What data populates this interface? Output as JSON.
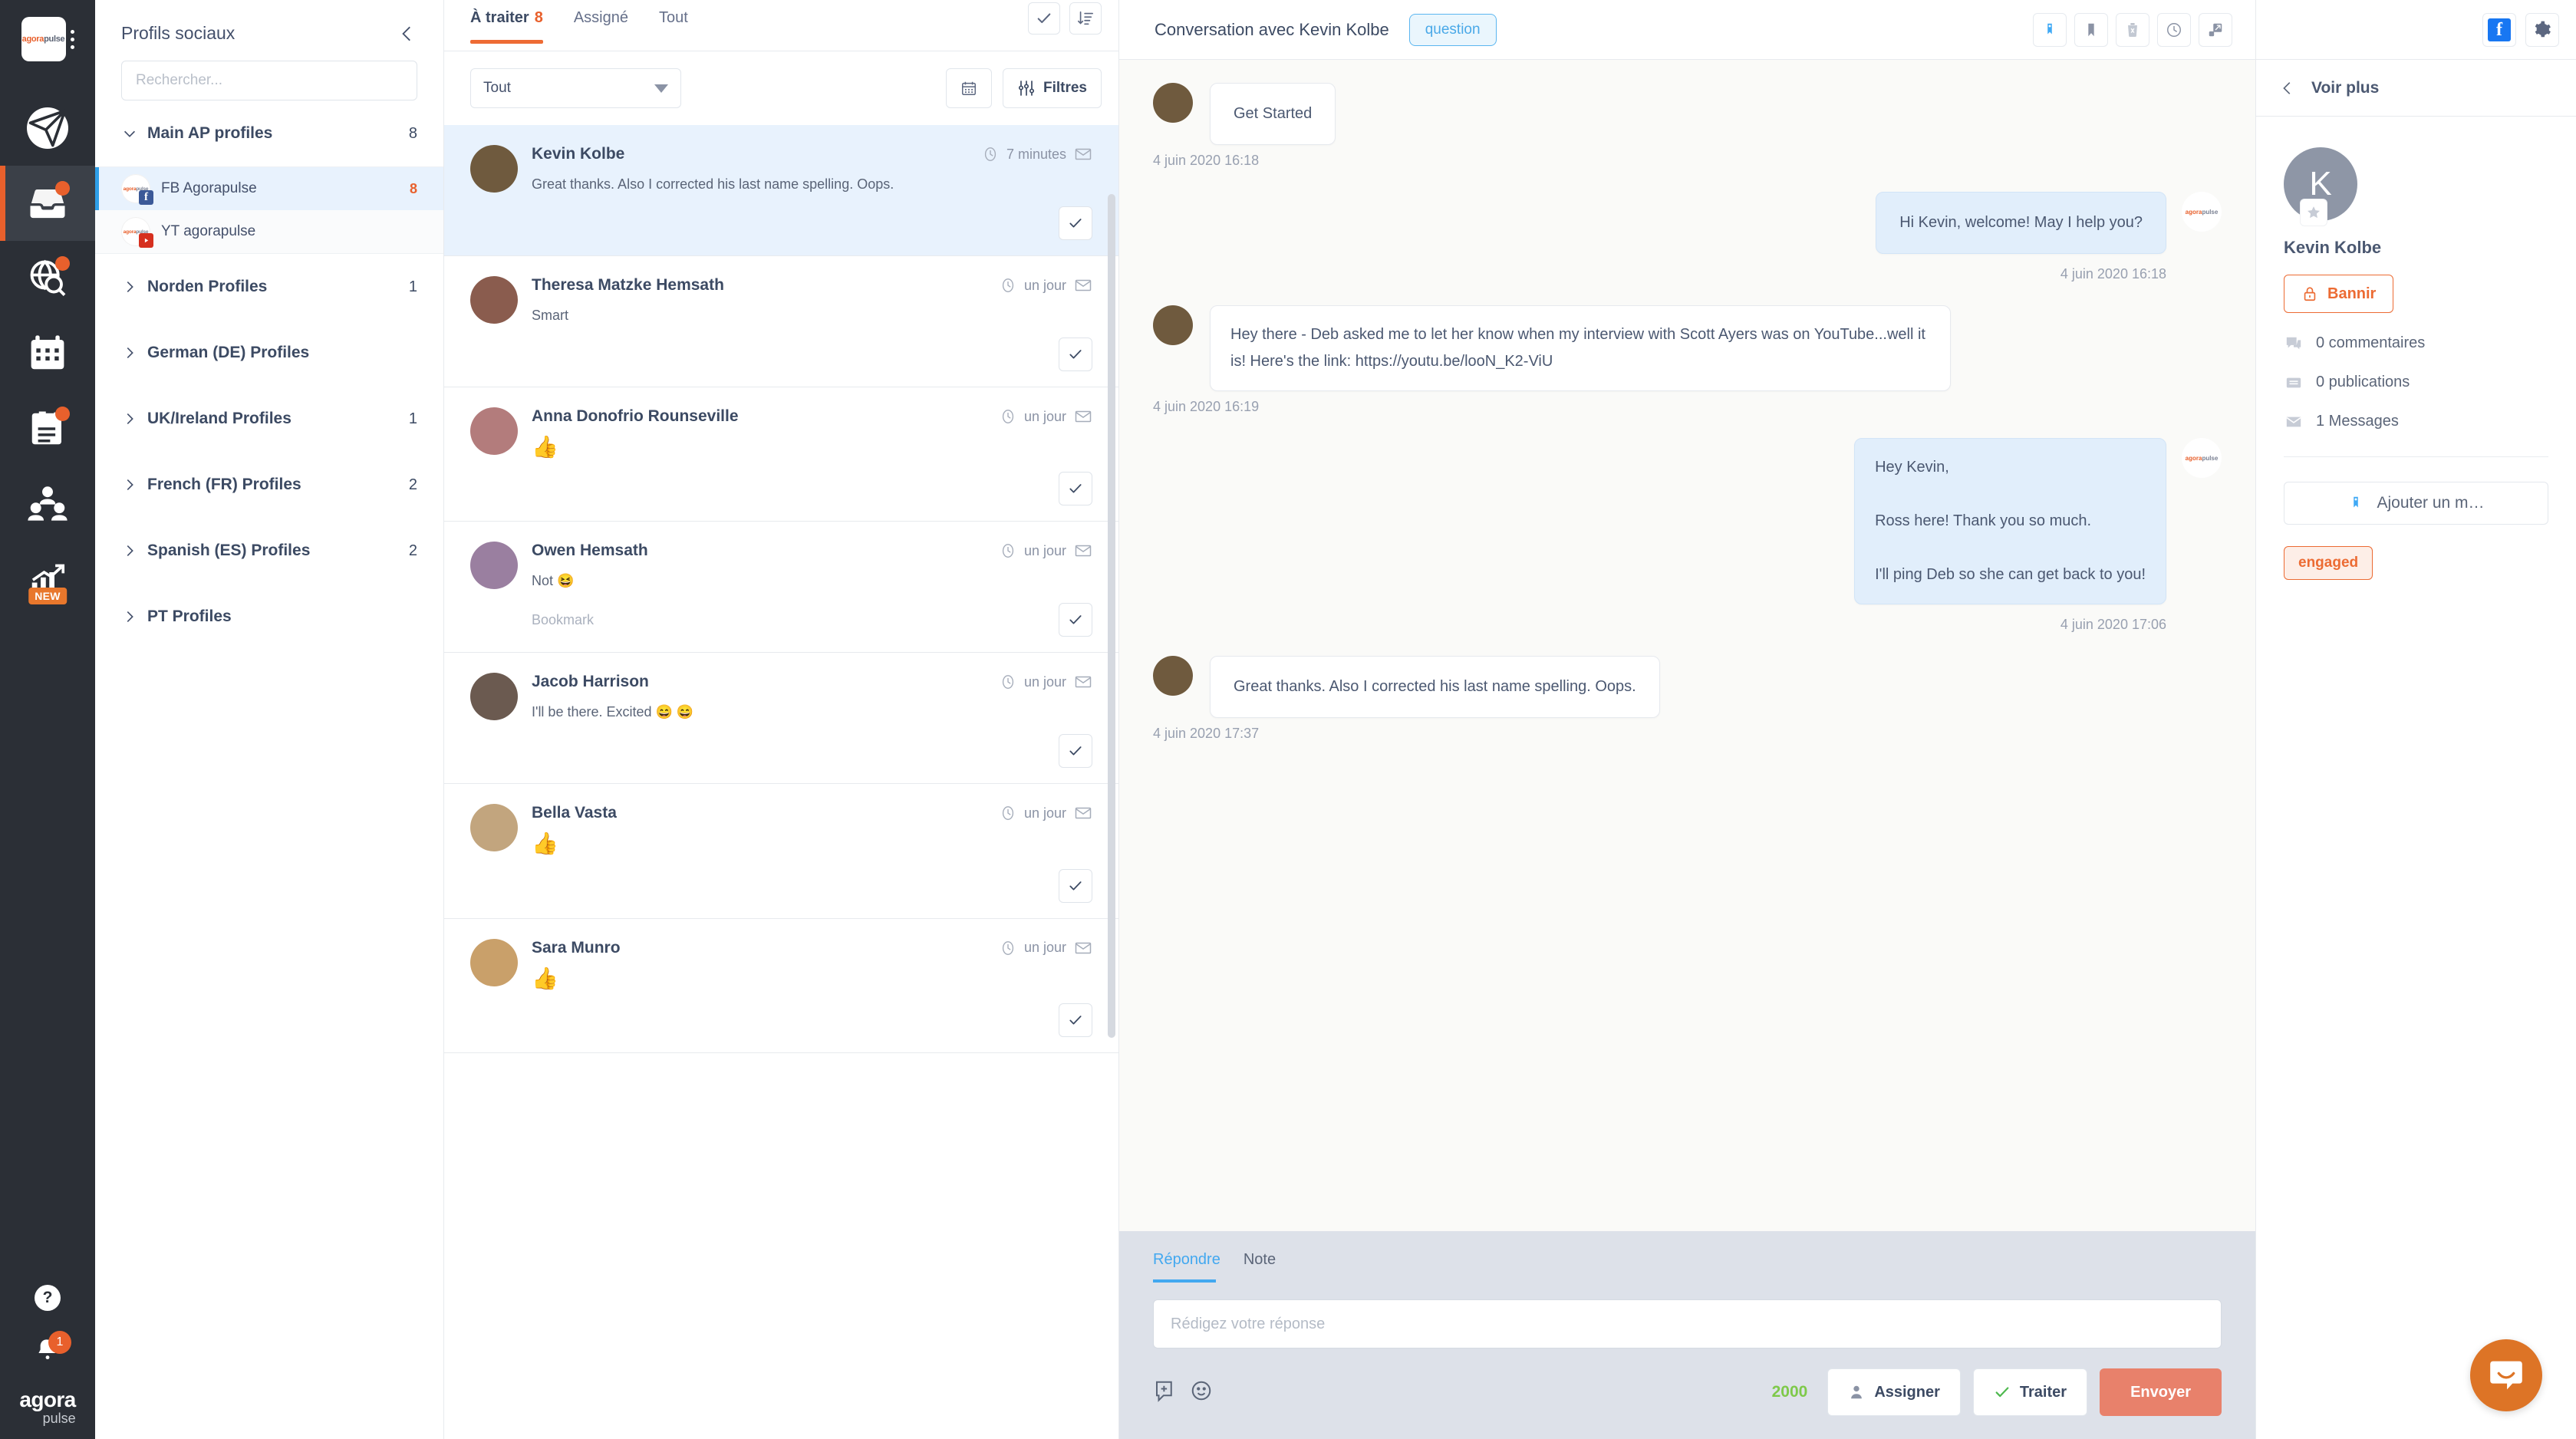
{
  "rail": {
    "brand_top": {
      "orange": "agora",
      "grey": "pulse"
    },
    "wordmark": {
      "line1": "agora",
      "line2": "pulse"
    },
    "items": [
      {
        "name": "publish",
        "icon": "paper-plane-icon",
        "badge": ""
      },
      {
        "name": "inbox",
        "icon": "inbox-icon",
        "badge": "dot"
      },
      {
        "name": "listening",
        "icon": "globe-search-icon",
        "badge": "dot"
      },
      {
        "name": "calendar",
        "icon": "calendar-icon",
        "badge": ""
      },
      {
        "name": "content",
        "icon": "clipboard-icon",
        "badge": "dot"
      },
      {
        "name": "team",
        "icon": "users-icon",
        "badge": ""
      },
      {
        "name": "reports",
        "icon": "chart-icon",
        "badge": "NEW"
      }
    ],
    "help_label": "?",
    "notification_count": "1"
  },
  "profiles": {
    "title": "Profils sociaux",
    "search_placeholder": "Rechercher...",
    "groups": [
      {
        "label": "Main AP profiles",
        "count": "8",
        "expanded": true,
        "profiles": [
          {
            "name": "FB Agorapulse",
            "count": "8",
            "network": "facebook",
            "selected": true
          },
          {
            "name": "YT agorapulse",
            "count": "",
            "network": "youtube",
            "selected": false
          }
        ]
      },
      {
        "label": "Norden Profiles",
        "count": "1",
        "expanded": false,
        "profiles": []
      },
      {
        "label": "German (DE) Profiles",
        "count": "",
        "expanded": false,
        "profiles": []
      },
      {
        "label": "UK/Ireland Profiles",
        "count": "1",
        "expanded": false,
        "profiles": []
      },
      {
        "label": "French (FR) Profiles",
        "count": "2",
        "expanded": false,
        "profiles": []
      },
      {
        "label": "Spanish (ES) Profiles",
        "count": "2",
        "expanded": false,
        "profiles": []
      },
      {
        "label": "PT Profiles",
        "count": "",
        "expanded": false,
        "profiles": []
      }
    ]
  },
  "conversation_list": {
    "tabs": [
      {
        "label": "À traiter",
        "count": "8",
        "active": true
      },
      {
        "label": "Assigné",
        "count": "",
        "active": false
      },
      {
        "label": "Tout",
        "count": "",
        "active": false
      }
    ],
    "select_value": "Tout",
    "filters_label": "Filtres",
    "items": [
      {
        "name": "Kevin Kolbe",
        "time": "7 minutes",
        "snippet": "Great thanks. Also I corrected his last name spelling. Oops.",
        "reaction": "",
        "bookmark": "",
        "selected": true,
        "avatar_color": "#6f5a3e"
      },
      {
        "name": "Theresa Matzke Hemsath",
        "time": "un jour",
        "snippet": "Smart",
        "reaction": "",
        "bookmark": "",
        "selected": false,
        "avatar_color": "#8a5c4e"
      },
      {
        "name": "Anna Donofrio Rounseville",
        "time": "un jour",
        "snippet": "",
        "reaction": "thumbs-up",
        "bookmark": "",
        "selected": false,
        "avatar_color": "#b37c7c"
      },
      {
        "name": "Owen Hemsath",
        "time": "un jour",
        "snippet": "Not 😆",
        "reaction": "",
        "bookmark": "Bookmark",
        "selected": false,
        "avatar_color": "#9a7fa0"
      },
      {
        "name": "Jacob Harrison",
        "time": "un jour",
        "snippet": "I'll be there. Excited 😄  😄",
        "reaction": "",
        "bookmark": "",
        "selected": false,
        "avatar_color": "#6b5a50"
      },
      {
        "name": "Bella Vasta",
        "time": "un jour",
        "snippet": "",
        "reaction": "thumbs-up",
        "bookmark": "",
        "selected": false,
        "avatar_color": "#c2a57e"
      },
      {
        "name": "Sara Munro",
        "time": "un jour",
        "snippet": "",
        "reaction": "thumbs-up",
        "bookmark": "",
        "selected": false,
        "avatar_color": "#c9a06a"
      }
    ]
  },
  "conversation": {
    "title": "Conversation avec Kevin Kolbe",
    "tag": "question",
    "actions": [
      "tag-icon",
      "bookmark-icon",
      "delete-icon",
      "clock-icon",
      "expand-icon"
    ],
    "messages": [
      {
        "side": "in",
        "text": "Get Started",
        "time": "4 juin 2020 16:18",
        "short": true
      },
      {
        "side": "out",
        "text": "Hi Kevin, welcome! May I help you?",
        "time": "4 juin 2020 16:18",
        "short": true
      },
      {
        "side": "in",
        "text": "Hey there - Deb asked me to let her know when my interview with Scott Ayers was on YouTube...well it is! Here's the link: https://youtu.be/looN_K2-ViU",
        "time": "4 juin 2020 16:19",
        "short": false
      },
      {
        "side": "out",
        "text": "Hey Kevin,\n\nRoss here! Thank you so much.\n\nI'll ping Deb so she can get back to you!",
        "time": "4 juin 2020 17:06",
        "short": false
      },
      {
        "side": "in",
        "text": "Great thanks. Also I corrected his last name spelling. Oops.",
        "time": "4 juin 2020 17:37",
        "short": true
      }
    ]
  },
  "reply": {
    "tabs": [
      {
        "label": "Répondre",
        "active": true
      },
      {
        "label": "Note",
        "active": false
      }
    ],
    "placeholder": "Rédigez votre réponse",
    "char_count": "2000",
    "assign_label": "Assigner",
    "process_label": "Traiter",
    "send_label": "Envoyer"
  },
  "rightbar": {
    "see_more": "Voir plus",
    "avatar_initial": "K",
    "name": "Kevin Kolbe",
    "ban_label": "Bannir",
    "stats": [
      {
        "icon": "comment-icon",
        "label": "0 commentaires"
      },
      {
        "icon": "post-icon",
        "label": "0 publications"
      },
      {
        "icon": "envelope-icon",
        "label": "1 Messages"
      }
    ],
    "add_tag_label": "Ajouter un m…",
    "tag": "engaged"
  },
  "colors": {
    "accent_orange": "#e8602c",
    "blue_select": "#e8f2fd",
    "rail_dark": "#2b2f36",
    "send_button": "#e8816b",
    "tag_blue": "#4aa9e8"
  }
}
